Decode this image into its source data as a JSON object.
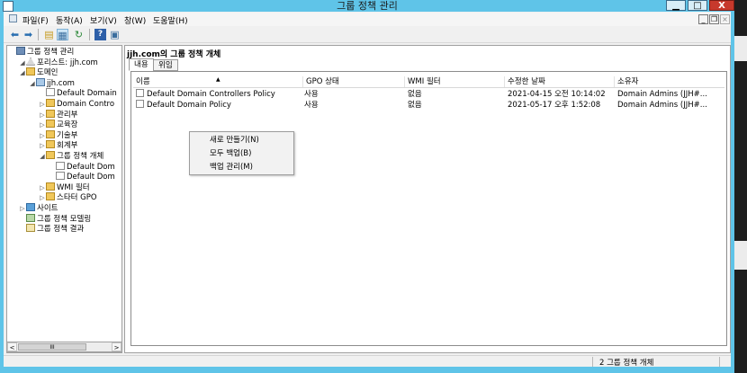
{
  "window": {
    "title": "그룹 정책 관리",
    "min_label": "▁",
    "max_label": "□",
    "close_label": "X"
  },
  "menubar": {
    "items": [
      "파일(F)",
      "동작(A)",
      "보기(V)",
      "창(W)",
      "도움말(H)"
    ],
    "mdi_min": "_",
    "mdi_restore": "❐",
    "mdi_close": "×"
  },
  "toolbar": {
    "icons": [
      "back-arrow-icon",
      "forward-arrow-icon",
      "up-folder-icon",
      "show-tree-icon",
      "refresh-icon",
      "help-icon",
      "console-icon"
    ]
  },
  "tree": {
    "items": [
      {
        "label": "그룹 정책 관리",
        "icon": "root"
      },
      {
        "label": "포리스트: jjh.com",
        "icon": "forest",
        "expander": "◢"
      },
      {
        "label": "도메인",
        "icon": "folder",
        "expander": "◢"
      },
      {
        "label": "jjh.com",
        "icon": "domain",
        "expander": "◢"
      },
      {
        "label": "Default Domain",
        "icon": "doc"
      },
      {
        "label": "Domain Contro",
        "icon": "folder",
        "expander": "▷"
      },
      {
        "label": "관리부",
        "icon": "folder",
        "expander": "▷"
      },
      {
        "label": "교육장",
        "icon": "folder",
        "expander": "▷"
      },
      {
        "label": "기술부",
        "icon": "folder",
        "expander": "▷"
      },
      {
        "label": "회계부",
        "icon": "folder",
        "expander": "▷"
      },
      {
        "label": "그룹 정책 개체",
        "icon": "folder",
        "expander": "◢"
      },
      {
        "label": "Default Dom",
        "icon": "doc"
      },
      {
        "label": "Default Dom",
        "icon": "doc"
      },
      {
        "label": "WMI 필터",
        "icon": "folder",
        "expander": "▷"
      },
      {
        "label": "스타터 GPO",
        "icon": "folder",
        "expander": "▷"
      },
      {
        "label": "사이트",
        "icon": "site",
        "expander": "▷"
      },
      {
        "label": "그룹 정책 모델링",
        "icon": "model"
      },
      {
        "label": "그룹 정책 결과",
        "icon": "result"
      }
    ],
    "scroll_left": "<",
    "scroll_right": ">",
    "scroll_thumb": "III"
  },
  "panel": {
    "title": "jjh.com의 그룹 정책 개체",
    "tabs": [
      "내용",
      "위임"
    ],
    "selected_tab": 0
  },
  "table": {
    "columns": [
      "이름",
      "GPO 상태",
      "WMI 필터",
      "수정한 날짜",
      "소유자"
    ],
    "sort_indicator": "▲",
    "rows": [
      [
        "Default Domain Controllers Policy",
        "사용",
        "없음",
        "2021-04-15 오전 10:14:02",
        "Domain Admins (JJH#..."
      ],
      [
        "Default Domain Policy",
        "사용",
        "없음",
        "2021-05-17 오후 1:52:08",
        "Domain Admins (JJH#..."
      ]
    ]
  },
  "context_menu": {
    "items": [
      "새로 만들기(N)",
      "모두 백업(B)",
      "백업 관리(M)"
    ]
  },
  "status": {
    "text": "2 그룹 정책 개체"
  }
}
